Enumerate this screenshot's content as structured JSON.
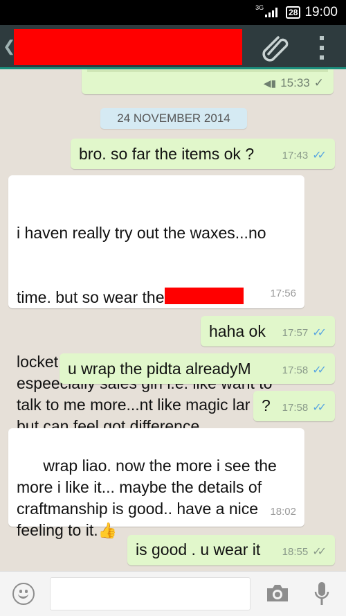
{
  "status_bar": {
    "network": "3G",
    "battery": "28",
    "time": "19:00"
  },
  "header": {
    "back_glyph": "❮",
    "icons": [
      "paperclip-icon",
      "overflow-menu-icon"
    ]
  },
  "chat": {
    "previous_message": {
      "time": "15:33",
      "status": "✓"
    },
    "date_divider": "24 NOVEMBER 2014",
    "messages": [
      {
        "dir": "out",
        "text": "bro. so far the items ok ?",
        "time": "17:43",
        "status": "✓✓"
      },
      {
        "dir": "in",
        "text_line1": "i haven really try out the waxes...no",
        "text_line2a": "time. but so wear the",
        "text_rest": "locket..got attract girls attention\nespeecially sales girl i.e. like want to\ntalk to me more...nt like magic lar\nbut can feel got difference.",
        "time": "17:56"
      },
      {
        "dir": "out",
        "text": "haha ok",
        "time": "17:57",
        "status": "✓✓"
      },
      {
        "dir": "out",
        "text": "u wrap the pidta alreadyM",
        "time": "17:58",
        "status": "✓✓"
      },
      {
        "dir": "out",
        "text": "?",
        "time": "17:58",
        "status": "✓✓"
      },
      {
        "dir": "in",
        "text": "wrap liao. now the more i see the\nmore i like it... maybe the details of\ncraftmanship is good.. have a nice\nfeeling to it.",
        "emoji": "👍",
        "time": "18:02"
      },
      {
        "dir": "out",
        "text": "is good . u wear it",
        "time": "18:55",
        "status": "✓✓"
      }
    ]
  },
  "footer": {
    "input_value": "",
    "input_placeholder": ""
  }
}
